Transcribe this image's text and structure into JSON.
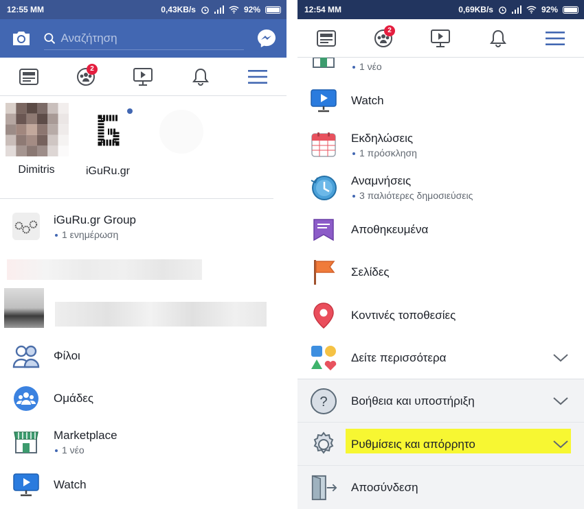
{
  "left": {
    "status": {
      "time": "12:55 MM",
      "speed": "0,43KB/s",
      "battery": "92%"
    },
    "search_placeholder": "Αναζήτηση",
    "nav_badge": "2",
    "shortcuts": [
      {
        "name": "Dimitris"
      },
      {
        "name": "iGuRu.gr"
      }
    ],
    "rows": {
      "group": {
        "label": "iGuRu.gr Group",
        "sub": "1 ενημέρωση"
      },
      "friends": {
        "label": "Φίλοι"
      },
      "groups": {
        "label": "Ομάδες"
      },
      "marketplace": {
        "label": "Marketplace",
        "sub": "1 νέο"
      },
      "watch": {
        "label": "Watch"
      }
    }
  },
  "right": {
    "status": {
      "time": "12:54 MM",
      "speed": "0,69KB/s",
      "battery": "92%"
    },
    "nav_badge": "2",
    "rows": {
      "marketplace_sub": "1 νέο",
      "watch": {
        "label": "Watch"
      },
      "events": {
        "label": "Εκδηλώσεις",
        "sub": "1 πρόσκληση"
      },
      "memories": {
        "label": "Αναμνήσεις",
        "sub": "3 παλιότερες δημοσιεύσεις"
      },
      "saved": {
        "label": "Αποθηκευμένα"
      },
      "pages": {
        "label": "Σελίδες"
      },
      "nearby": {
        "label": "Κοντινές τοποθεσίες"
      },
      "see_more": {
        "label": "Δείτε περισσότερα"
      },
      "help": {
        "label": "Βοήθεια και υποστήριξη"
      },
      "settings": {
        "label": "Ρυθμίσεις και απόρρητο"
      },
      "logout": {
        "label": "Αποσύνδεση"
      }
    }
  },
  "colors": {
    "fb_blue": "#4267b2",
    "dark_status": "#22355f",
    "highlight": "#f7f732",
    "badge": "#e41e3f"
  }
}
